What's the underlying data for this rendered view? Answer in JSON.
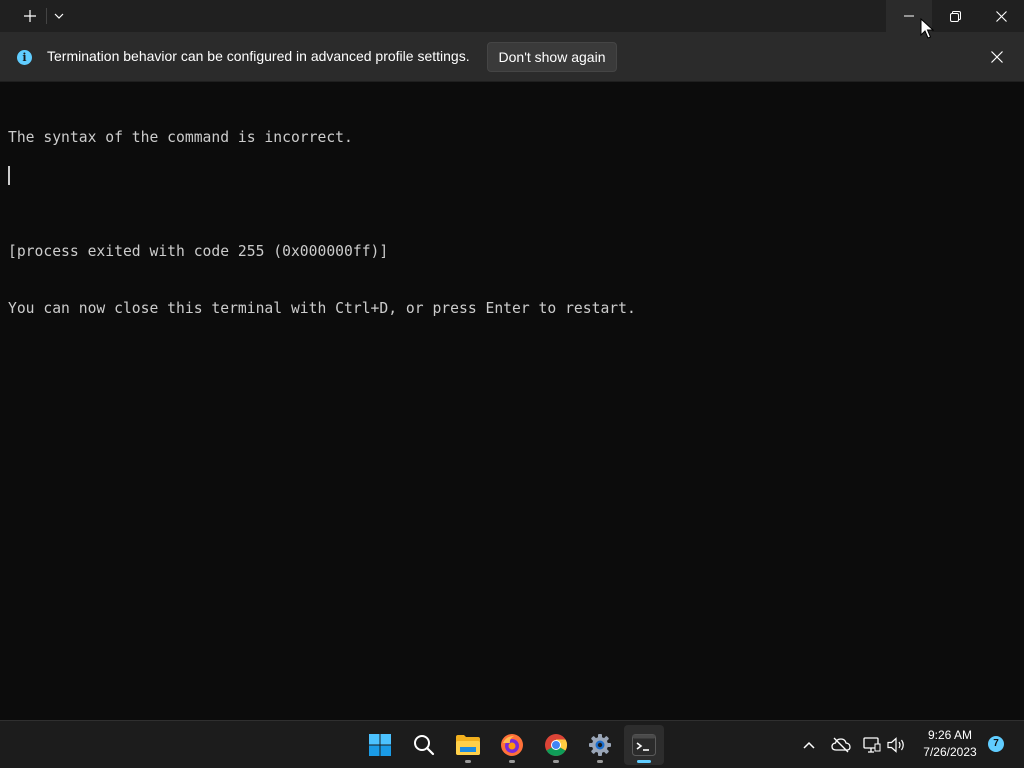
{
  "titlebar": {
    "new_tab_icon": "plus-icon",
    "dropdown_icon": "chevron-down-icon"
  },
  "infobar": {
    "message": "Termination behavior can be configured in advanced profile settings.",
    "button_label": "Don't show again",
    "icon": "info-icon",
    "info_glyph": "i"
  },
  "terminal": {
    "lines": [
      "The syntax of the command is incorrect.",
      "",
      "[process exited with code 255 (0x000000ff)]",
      "You can now close this terminal with Ctrl+D, or press Enter to restart."
    ]
  },
  "taskbar": {
    "apps": [
      "start",
      "search",
      "file-explorer",
      "firefox",
      "chrome",
      "settings",
      "terminal"
    ],
    "clock_time": "9:26 AM",
    "clock_date": "7/26/2023",
    "notification_count": "7"
  },
  "colors": {
    "background": "#0c0c0c",
    "titlebar": "#202020",
    "infobar": "#2b2b2b",
    "accent": "#60cdff",
    "text": "#cccccc"
  }
}
